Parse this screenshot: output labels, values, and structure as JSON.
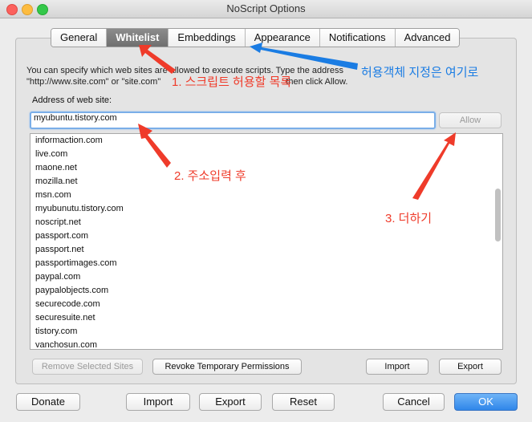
{
  "window": {
    "title": "NoScript Options"
  },
  "tabs": [
    {
      "label": "General"
    },
    {
      "label": "Whitelist",
      "active": true
    },
    {
      "label": "Embeddings"
    },
    {
      "label": "Appearance"
    },
    {
      "label": "Notifications"
    },
    {
      "label": "Advanced"
    }
  ],
  "whitelist": {
    "description_line1": "You can specify which web sites are allowed to execute scripts. Type the address",
    "description_line2": "\"http://www.site.com\" or \"site.com\"",
    "description_line2_end": "then click Allow.",
    "address_label": "Address of web site:",
    "address_value": "myubuntu.tistory.com",
    "allow_label": "Allow",
    "sites": [
      "informaction.com",
      "live.com",
      "maone.net",
      "mozilla.net",
      "msn.com",
      "myubunutu.tistory.com",
      "noscript.net",
      "passport.com",
      "passport.net",
      "passportimages.com",
      "paypal.com",
      "paypalobjects.com",
      "securecode.com",
      "securesuite.net",
      "tistory.com",
      "vanchosun.com"
    ],
    "remove_label": "Remove Selected Sites",
    "revoke_label": "Revoke Temporary Permissions",
    "import_label": "Import",
    "export_label": "Export"
  },
  "footer": {
    "donate_label": "Donate",
    "import_label": "Import",
    "export_label": "Export",
    "reset_label": "Reset",
    "cancel_label": "Cancel",
    "ok_label": "OK"
  },
  "annotations": {
    "step1": "1. 스크립트 허용할 목록",
    "step2": "2. 주소입력 후",
    "step3": "3. 더하기",
    "embeddings_note": "허용객체 지정은 여기로"
  },
  "colors": {
    "annotation_red": "#ef3b2a",
    "annotation_blue": "#1a7ce3",
    "ok_button": "#2f86e9"
  }
}
